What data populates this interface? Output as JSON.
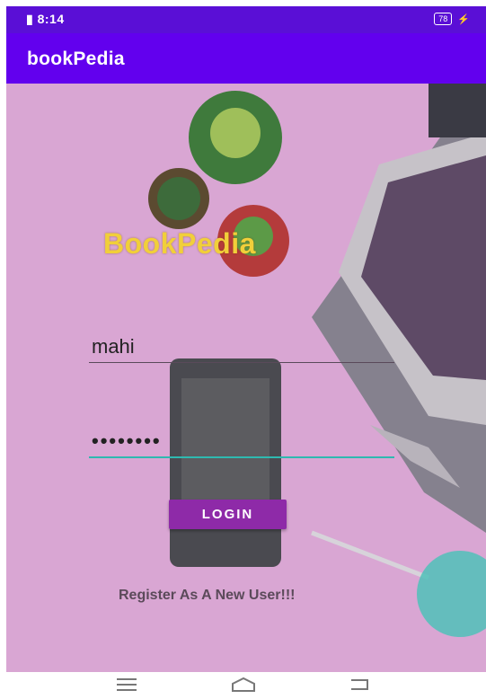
{
  "status_bar": {
    "left": "8:14",
    "battery": "78"
  },
  "app_bar": {
    "title": "bookPedia"
  },
  "login_screen": {
    "brand": "BookPedia",
    "username_value": "mahi",
    "password_mask": "••••••••",
    "login_label": "LOGIN",
    "register_link": "Register As A New User!!!"
  },
  "nav": {
    "icons": [
      "menu-icon",
      "home-icon",
      "back-icon"
    ]
  }
}
